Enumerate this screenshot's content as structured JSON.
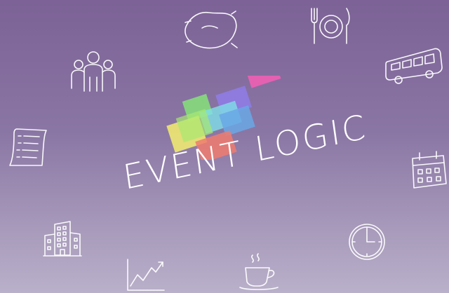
{
  "brand": {
    "name": "EVENT LOGIC",
    "colors": {
      "background_top": "#7c6296",
      "background_bottom": "#b9b0ca",
      "green": "#86e27a",
      "yellow": "#f5ef6e",
      "cyan": "#7fe0e8",
      "blue": "#6aa8e6",
      "violet": "#8f7ce8",
      "pink": "#ee5fb4",
      "coral": "#f07b6e",
      "white": "#ffffff"
    }
  },
  "decorations": [
    "pillow-icon",
    "dining-plate-icon",
    "people-group-icon",
    "bus-icon",
    "document-list-icon",
    "calendar-icon",
    "office-building-icon",
    "clock-icon",
    "growth-chart-icon",
    "coffee-cup-icon"
  ]
}
